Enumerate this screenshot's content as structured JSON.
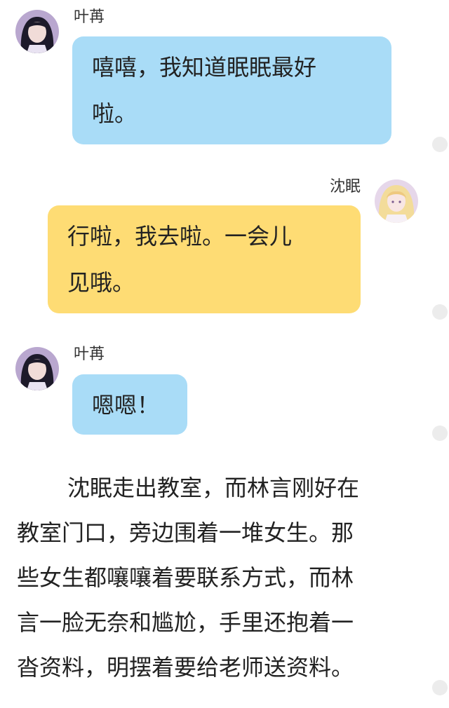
{
  "messages": [
    {
      "speaker": "叶苒",
      "side": "left",
      "avatar": "dark-haired-girl-avatar",
      "lines": [
        "嘻嘻，我知道眠眠最好",
        "啦。"
      ]
    },
    {
      "speaker": "沈眠",
      "side": "right",
      "avatar": "blonde-girl-avatar",
      "lines": [
        "行啦，我去啦。一会儿",
        "见哦。"
      ]
    },
    {
      "speaker": "叶苒",
      "side": "left",
      "avatar": "dark-haired-girl-avatar",
      "lines": [
        "嗯嗯！"
      ]
    }
  ],
  "narration": {
    "lines": [
      "沈眠走出教室，而林言刚好在",
      "教室门口，旁边围着一堆女生。那",
      "些女生都嚷嚷着要联系方式，而林",
      "言一脸无奈和尴尬，手里还抱着一",
      "沓资料，明摆着要给老师送资料。"
    ]
  },
  "colors": {
    "left_bubble": "#a9dcf7",
    "right_bubble": "#fedc74",
    "scroll_dot": "#ececec",
    "background": "#ffffff"
  }
}
